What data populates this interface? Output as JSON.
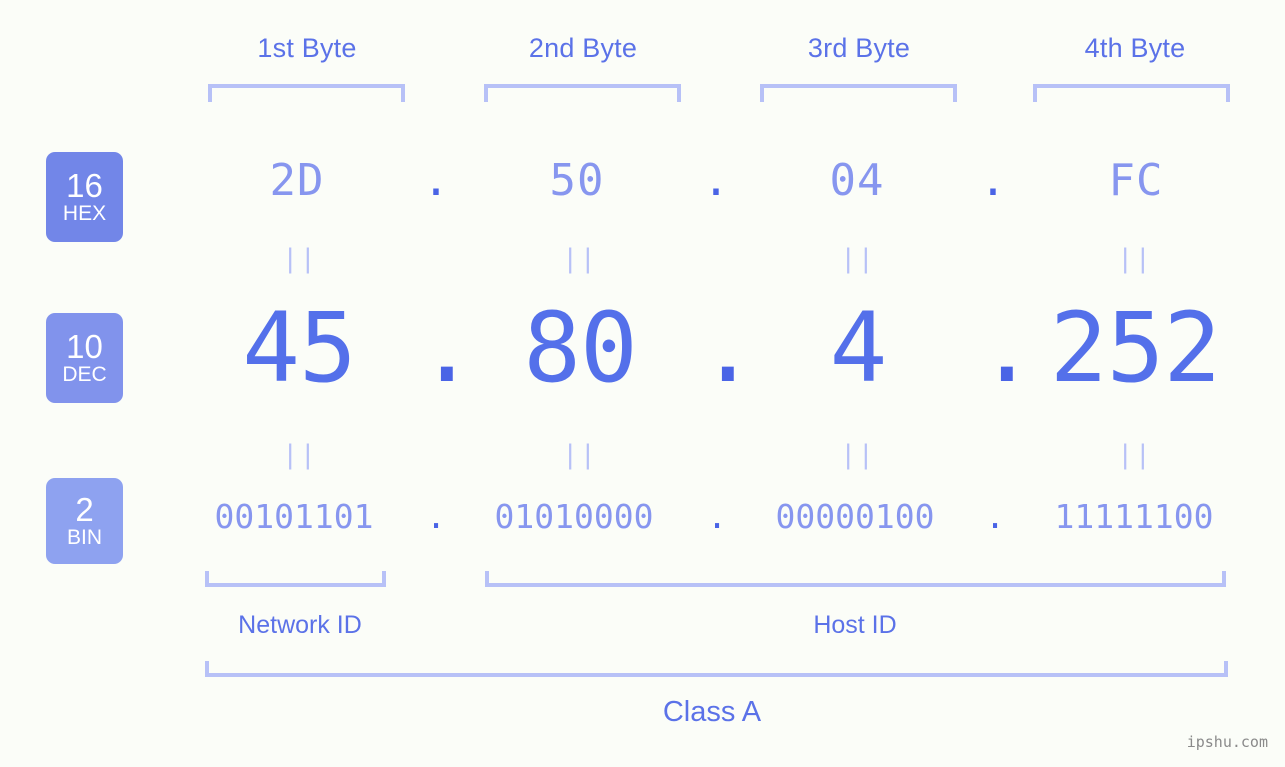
{
  "byte_headers": [
    {
      "label": "1st Byte"
    },
    {
      "label": "2nd Byte"
    },
    {
      "label": "3rd Byte"
    },
    {
      "label": "4th Byte"
    }
  ],
  "rows": {
    "hex": {
      "badge_number": "16",
      "badge_name": "HEX",
      "values": [
        "2D",
        "50",
        "04",
        "FC"
      ],
      "separator": "."
    },
    "dec": {
      "badge_number": "10",
      "badge_name": "DEC",
      "values": [
        "45",
        "80",
        "4",
        "252"
      ],
      "separator": "."
    },
    "bin": {
      "badge_number": "2",
      "badge_name": "BIN",
      "values": [
        "00101101",
        "01010000",
        "00000100",
        "11111100"
      ],
      "separator": "."
    }
  },
  "equality_marks": {
    "symbol": "||",
    "count_per_row": 4
  },
  "sections": {
    "network_id": "Network ID",
    "host_id": "Host ID",
    "class": "Class A"
  },
  "watermark": "ipshu.com",
  "colors": {
    "background": "#fbfdf8",
    "accent_dark": "#4a64e6",
    "accent_mid": "#5b72e8",
    "accent_light": "#8796ef",
    "bracket": "#b7c1f7",
    "badge_hex": "#7286e8",
    "badge_dec": "#8193ec",
    "badge_bin": "#8ea2f0",
    "watermark": "#8a8a8a"
  }
}
